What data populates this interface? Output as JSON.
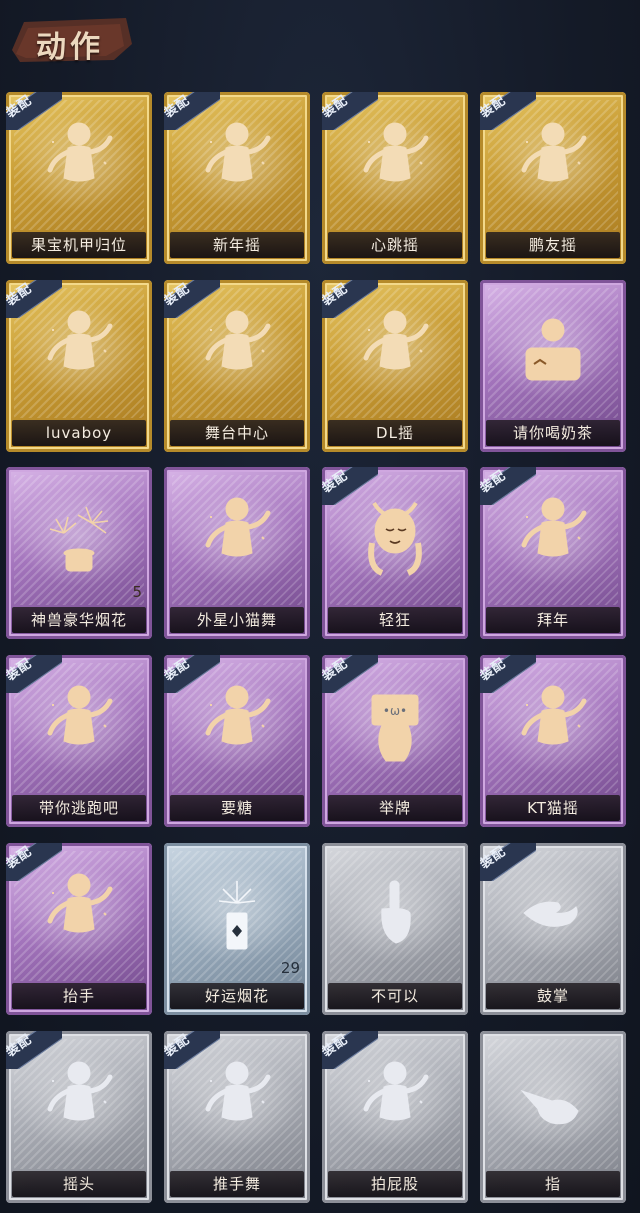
{
  "header": {
    "title": "动作"
  },
  "equip_tag": "装配",
  "cards": [
    {
      "label": "果宝机甲归位",
      "tier": "gold",
      "equipped": true,
      "icon": "dance-figure-icon"
    },
    {
      "label": "新年摇",
      "tier": "gold",
      "equipped": true,
      "icon": "dance-figure-icon"
    },
    {
      "label": "心跳摇",
      "tier": "gold",
      "equipped": true,
      "icon": "dance-figure-icon"
    },
    {
      "label": "鹏友摇",
      "tier": "gold",
      "equipped": true,
      "icon": "dance-figure-icon"
    },
    {
      "label": "luvaboy",
      "tier": "gold",
      "equipped": true,
      "icon": "dance-figure-icon"
    },
    {
      "label": "舞台中心",
      "tier": "gold",
      "equipped": true,
      "icon": "dance-figure-icon"
    },
    {
      "label": "DL摇",
      "tier": "gold",
      "equipped": true,
      "icon": "dance-figure-icon"
    },
    {
      "label": "请你喝奶茶",
      "tier": "purple",
      "equipped": false,
      "icon": "milk-tea-icon"
    },
    {
      "label": "神兽豪华烟花",
      "tier": "purple",
      "equipped": false,
      "icon": "fireworks-icon",
      "count": "5"
    },
    {
      "label": "外星小猫舞",
      "tier": "purple",
      "equipped": false,
      "icon": "dance-figure-icon"
    },
    {
      "label": "轻狂",
      "tier": "purple",
      "equipped": true,
      "icon": "horned-girl-icon"
    },
    {
      "label": "拜年",
      "tier": "purple",
      "equipped": true,
      "icon": "dance-figure-icon"
    },
    {
      "label": "带你逃跑吧",
      "tier": "purple",
      "equipped": true,
      "icon": "dance-figure-icon"
    },
    {
      "label": "要糖",
      "tier": "purple",
      "equipped": true,
      "icon": "dance-figure-icon"
    },
    {
      "label": "举牌",
      "tier": "purple",
      "equipped": true,
      "icon": "sign-holding-icon"
    },
    {
      "label": "KT猫摇",
      "tier": "purple",
      "equipped": true,
      "icon": "dance-figure-icon"
    },
    {
      "label": "抬手",
      "tier": "purple",
      "equipped": true,
      "icon": "dance-figure-icon"
    },
    {
      "label": "好运烟花",
      "tier": "bluegrey",
      "equipped": false,
      "icon": "firecracker-icon",
      "count": "29"
    },
    {
      "label": "不可以",
      "tier": "grey",
      "equipped": false,
      "icon": "finger-wag-icon"
    },
    {
      "label": "鼓掌",
      "tier": "grey",
      "equipped": true,
      "icon": "clapping-hands-icon"
    },
    {
      "label": "摇头",
      "tier": "grey",
      "equipped": true,
      "icon": "dance-figure-icon"
    },
    {
      "label": "推手舞",
      "tier": "grey",
      "equipped": true,
      "icon": "dance-figure-icon"
    },
    {
      "label": "拍屁股",
      "tier": "grey",
      "equipped": true,
      "icon": "dance-figure-icon"
    },
    {
      "label": "指",
      "tier": "grey",
      "equipped": false,
      "icon": "pointing-hand-icon"
    }
  ]
}
